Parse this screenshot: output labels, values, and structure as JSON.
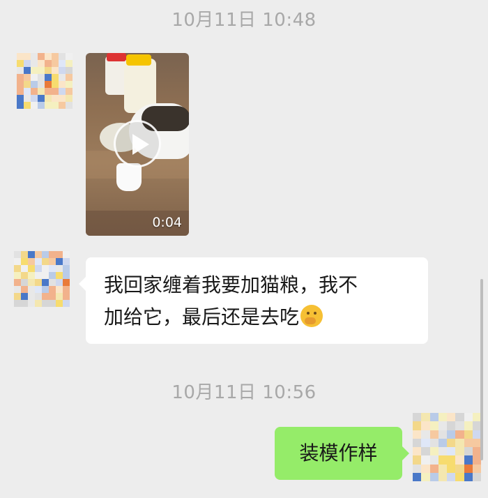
{
  "chat": {
    "messages": [
      {
        "type": "timestamp",
        "text": "10月11日 10:48"
      },
      {
        "type": "video",
        "sender": "contact",
        "duration": "0:04"
      },
      {
        "type": "text",
        "sender": "contact",
        "line1": "我回家缠着我要加猫粮，我不",
        "line2": "加给它，最后还是去吃"
      },
      {
        "type": "timestamp",
        "text": "10月11日 10:56"
      },
      {
        "type": "text",
        "sender": "me",
        "text": "装模作样"
      }
    ]
  },
  "icons": {
    "play": "play-circle-icon",
    "emoji": "thinking-face-emoji-icon"
  },
  "colors": {
    "background": "#ededed",
    "incoming_bubble": "#ffffff",
    "outgoing_bubble": "#95ec69",
    "timestamp_text": "#a8a8a8"
  }
}
